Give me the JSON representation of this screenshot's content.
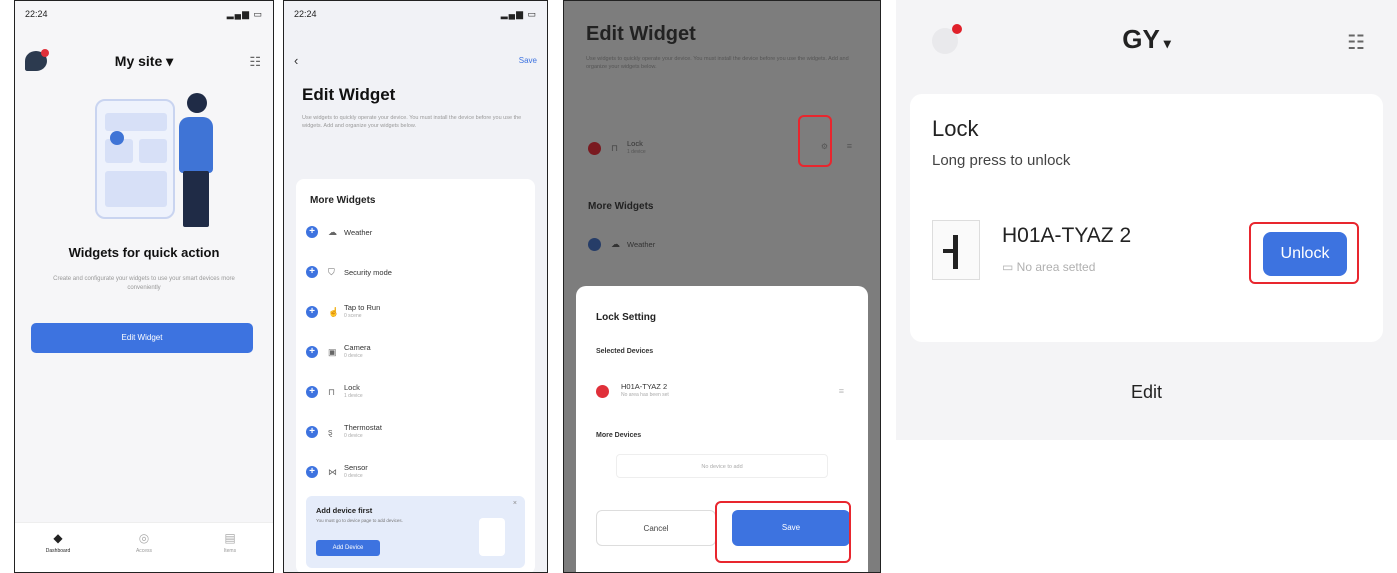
{
  "panel1": {
    "time": "22:24",
    "title": "My site",
    "heading": "Widgets for quick action",
    "subtitle": "Create and configurate your widgets to use your smart devices more conveniently",
    "button": "Edit Widget",
    "tabs": [
      "Dashboard",
      "Access",
      "Items"
    ]
  },
  "panel2": {
    "time": "22:24",
    "save": "Save",
    "title": "Edit Widget",
    "description": "Use widgets to quickly operate your device. You must install the device before you use the widgets. Add and organize your widgets below.",
    "section": "More Widgets",
    "widgets": [
      {
        "label": "Weather",
        "sub": ""
      },
      {
        "label": "Security mode",
        "sub": ""
      },
      {
        "label": "Tap to Run",
        "sub": "0 scene"
      },
      {
        "label": "Camera",
        "sub": "0 device"
      },
      {
        "label": "Lock",
        "sub": "1 device"
      },
      {
        "label": "Thermostat",
        "sub": "0 device"
      },
      {
        "label": "Sensor",
        "sub": "0 device"
      }
    ],
    "banner_title": "Add device first",
    "banner_desc": "You must go to device page to add devices.",
    "banner_button": "Add Device"
  },
  "panel3": {
    "title": "Edit Widget",
    "description": "Use widgets to quickly operate your device. You must install the device before you use the widgets. Add and organize your widgets below.",
    "lock_label": "Lock",
    "lock_sub": "1 device",
    "more_widgets": "More Widgets",
    "weather": "Weather",
    "sheet_title": "Lock Setting",
    "selected_devices": "Selected Devices",
    "device_name": "H01A-TYAZ 2",
    "device_sub": "No area has been set",
    "more_devices": "More Devices",
    "no_device": "No device to add",
    "cancel": "Cancel",
    "save": "Save"
  },
  "panel4": {
    "title": "GY",
    "card_title": "Lock",
    "card_sub": "Long press to unlock",
    "device_name": "H01A-TYAZ 2",
    "device_sub": "No area setted",
    "unlock": "Unlock",
    "edit": "Edit"
  },
  "colors": {
    "accent": "#3d73e0",
    "highlight": "#e8262e"
  }
}
